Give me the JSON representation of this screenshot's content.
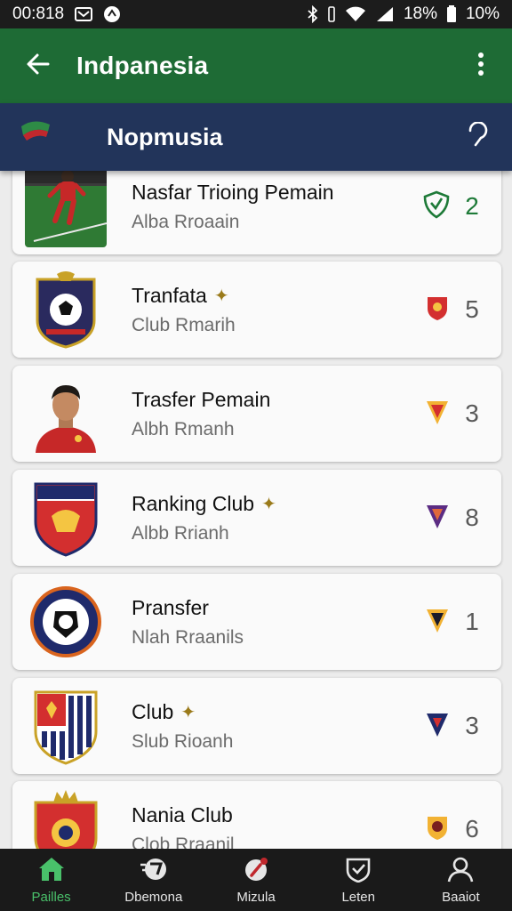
{
  "status_bar": {
    "time": "00:818",
    "battery_text": "18%",
    "battery_text_2": "10%",
    "icons": [
      "square-notification-icon",
      "app-notification-icon",
      "bluetooth-icon",
      "vibrate-icon",
      "wifi-icon",
      "signal-icon",
      "battery-icon"
    ]
  },
  "app_bar": {
    "title": "Indpanesia",
    "back_icon": "arrow-left-icon",
    "menu_icon": "more-vertical-icon",
    "color": "#1e6b35"
  },
  "sub_header": {
    "title": "Nopmusia",
    "help_icon": "help-icon",
    "color": "#22345a"
  },
  "items": [
    {
      "title": "Nasfar Trioing Pemain",
      "subtitle": "Alba Rroaain",
      "count": "2",
      "badge_icon": "shield-check-icon",
      "thumb": "player-photo"
    },
    {
      "title": "Tranfata",
      "subtitle": "Club Rmarih",
      "count": "5",
      "badge_icon": "red-shield-icon",
      "thumb": "club-crest-ball"
    },
    {
      "title": "Trasfer Pemain",
      "subtitle": "Albh Rmanh",
      "count": "3",
      "badge_icon": "red-yellow-shield-icon",
      "thumb": "player-portrait"
    },
    {
      "title": "Ranking Club",
      "subtitle": "Albb Rrianh",
      "count": "8",
      "badge_icon": "purple-shield-icon",
      "thumb": "club-crest-red"
    },
    {
      "title": "Pransfer",
      "subtitle": "Nlah Rraanils",
      "count": "1",
      "badge_icon": "black-shield-icon",
      "thumb": "club-crest-circle"
    },
    {
      "title": "Club",
      "subtitle": "Slub Rioanh",
      "count": "3",
      "badge_icon": "navy-shield-icon",
      "thumb": "club-crest-striped"
    },
    {
      "title": "Nania Club",
      "subtitle": "Clob Rraanil",
      "count": "6",
      "badge_icon": "gold-shield-icon",
      "thumb": "club-crest-crown"
    }
  ],
  "bottom_nav": [
    {
      "label": "Pailles",
      "icon": "home-icon",
      "active": true
    },
    {
      "label": "Dbemona",
      "icon": "ball-speed-icon",
      "active": false
    },
    {
      "label": "Mizula",
      "icon": "ball-edit-icon",
      "active": false
    },
    {
      "label": "Leten",
      "icon": "badge-check-icon",
      "active": false
    },
    {
      "label": "Baaiot",
      "icon": "profile-icon",
      "active": false
    }
  ],
  "colors": {
    "accent_green": "#1e6b35",
    "active_nav": "#49c06a",
    "header_navy": "#22345a"
  }
}
